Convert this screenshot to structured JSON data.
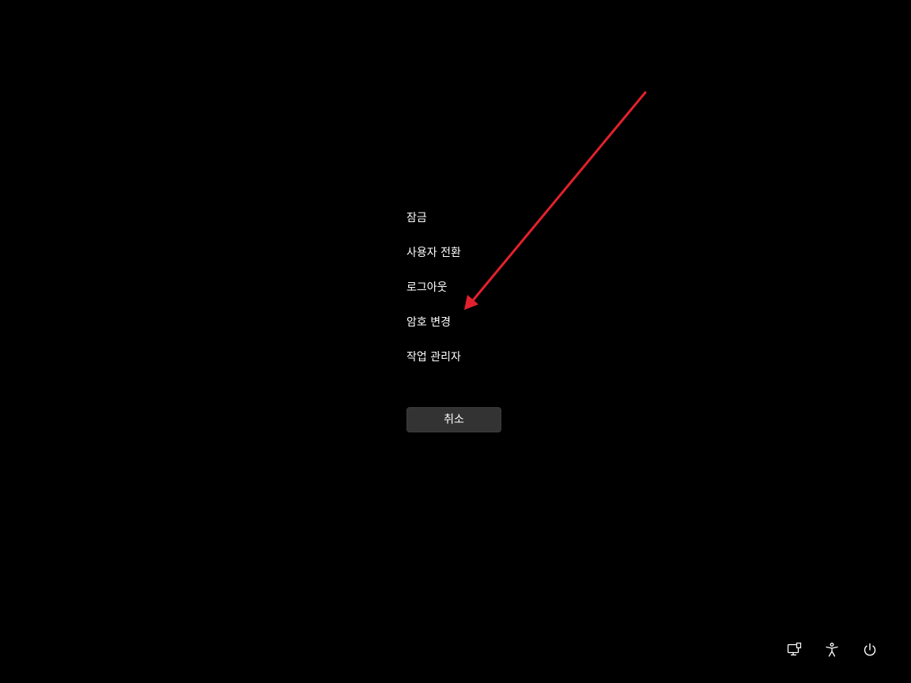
{
  "menu": {
    "items": [
      {
        "label": "잠금"
      },
      {
        "label": "사용자 전환"
      },
      {
        "label": "로그아웃"
      },
      {
        "label": "암호 변경"
      },
      {
        "label": "작업 관리자"
      }
    ]
  },
  "cancel_button": {
    "label": "취소"
  },
  "annotation": {
    "color": "#e3212d",
    "icon": "red-arrow"
  },
  "tray": {
    "icons": [
      {
        "name": "network-icon"
      },
      {
        "name": "accessibility-icon"
      },
      {
        "name": "power-icon"
      }
    ]
  },
  "colors": {
    "background": "#000000",
    "text": "#ffffff",
    "button": "#333333"
  }
}
